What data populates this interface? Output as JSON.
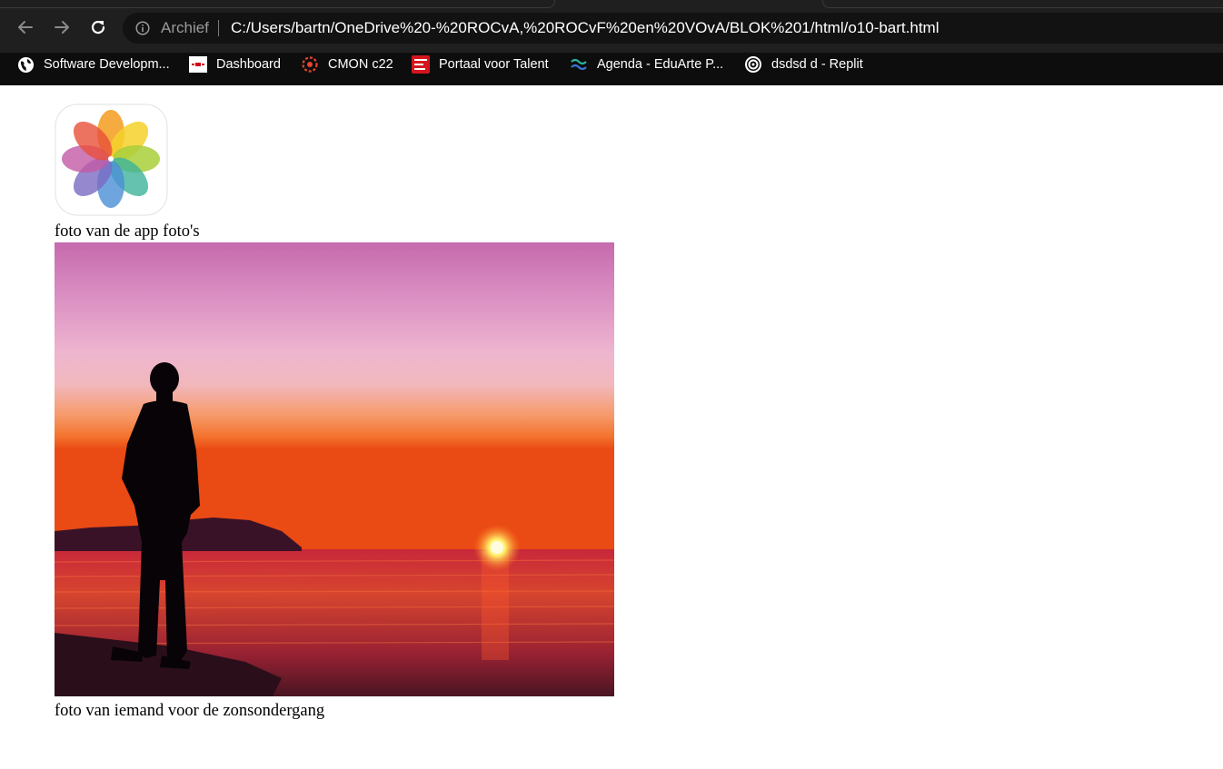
{
  "browser": {
    "address_label": "Archief",
    "url": "C:/Users/bartn/OneDrive%20-%20ROCvA,%20ROCvF%20en%20VOvA/BLOK%201/html/o10-bart.html",
    "bookmarks": [
      {
        "label": "Software Developm...",
        "icon": "globe-icon"
      },
      {
        "label": "Dashboard",
        "icon": "dashboard-icon"
      },
      {
        "label": "CMON c22",
        "icon": "cmon-icon"
      },
      {
        "label": "Portaal voor Talent",
        "icon": "portaal-icon"
      },
      {
        "label": "Agenda - EduArte P...",
        "icon": "eduarte-icon"
      },
      {
        "label": "dsdsd d - Replit",
        "icon": "replit-icon"
      }
    ]
  },
  "page": {
    "caption1": "foto van de app foto's",
    "caption2": "foto van iemand voor de zonsondergang"
  },
  "colors": {
    "toolbar": "#1f1f1f",
    "omnibox": "#121212",
    "bookmarks_bar": "#0d0d0d",
    "page_bg": "#ffffff"
  }
}
